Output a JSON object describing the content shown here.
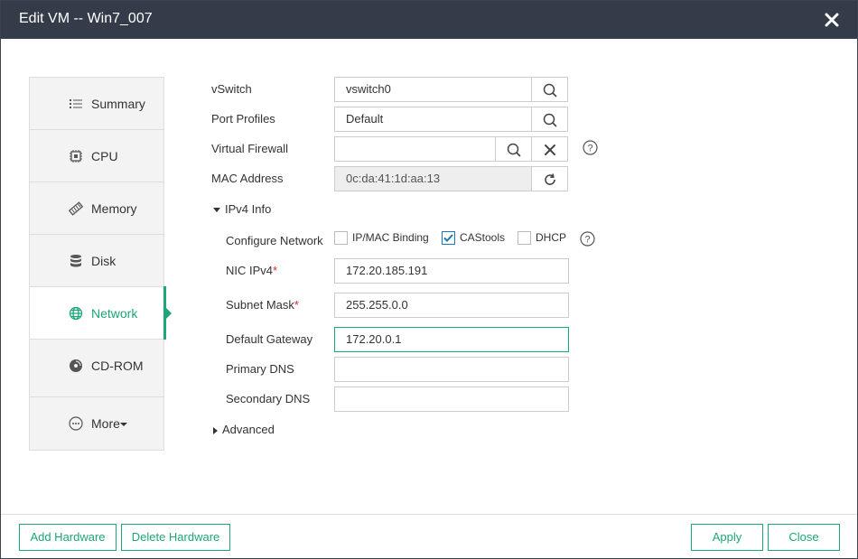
{
  "window": {
    "title": "Edit VM -- Win7_007"
  },
  "sidebar": {
    "items": [
      {
        "label": "Summary",
        "icon": "list-icon"
      },
      {
        "label": "CPU",
        "icon": "chip-icon"
      },
      {
        "label": "Memory",
        "icon": "memory-icon"
      },
      {
        "label": "Disk",
        "icon": "database-icon"
      },
      {
        "label": "Network",
        "icon": "globe-icon",
        "active": true
      },
      {
        "label": "CD-ROM",
        "icon": "disc-icon"
      },
      {
        "label": "More",
        "icon": "more-icon"
      }
    ]
  },
  "form": {
    "vswitch": {
      "label": "vSwitch",
      "value": "vswitch0"
    },
    "port_profiles": {
      "label": "Port Profiles",
      "value": "Default"
    },
    "virtual_firewall": {
      "label": "Virtual Firewall",
      "value": ""
    },
    "mac_address": {
      "label": "MAC Address",
      "value": "0c:da:41:1d:aa:13"
    },
    "ipv4_section": "IPv4 Info",
    "configure_network": {
      "label": "Configure Network",
      "options": [
        {
          "label": "IP/MAC Binding",
          "checked": false
        },
        {
          "label": "CAStools",
          "checked": true
        },
        {
          "label": "DHCP",
          "checked": false
        }
      ]
    },
    "nic_ipv4": {
      "label": "NIC IPv4",
      "required": "*",
      "value": "172.20.185.191"
    },
    "subnet_mask": {
      "label": "Subnet Mask",
      "required": "*",
      "value": "255.255.0.0"
    },
    "default_gateway": {
      "label": "Default Gateway",
      "value": "172.20.0.1"
    },
    "primary_dns": {
      "label": "Primary DNS",
      "value": ""
    },
    "secondary_dns": {
      "label": "Secondary DNS",
      "value": ""
    },
    "advanced_section": "Advanced"
  },
  "footer": {
    "add_hardware": "Add Hardware",
    "delete_hardware": "Delete Hardware",
    "apply": "Apply",
    "close": "Close"
  },
  "colors": {
    "accent": "#1ea67a",
    "titlebar": "#333c48",
    "required": "#e0262d",
    "checkbox_check": "#1a7ab8"
  }
}
